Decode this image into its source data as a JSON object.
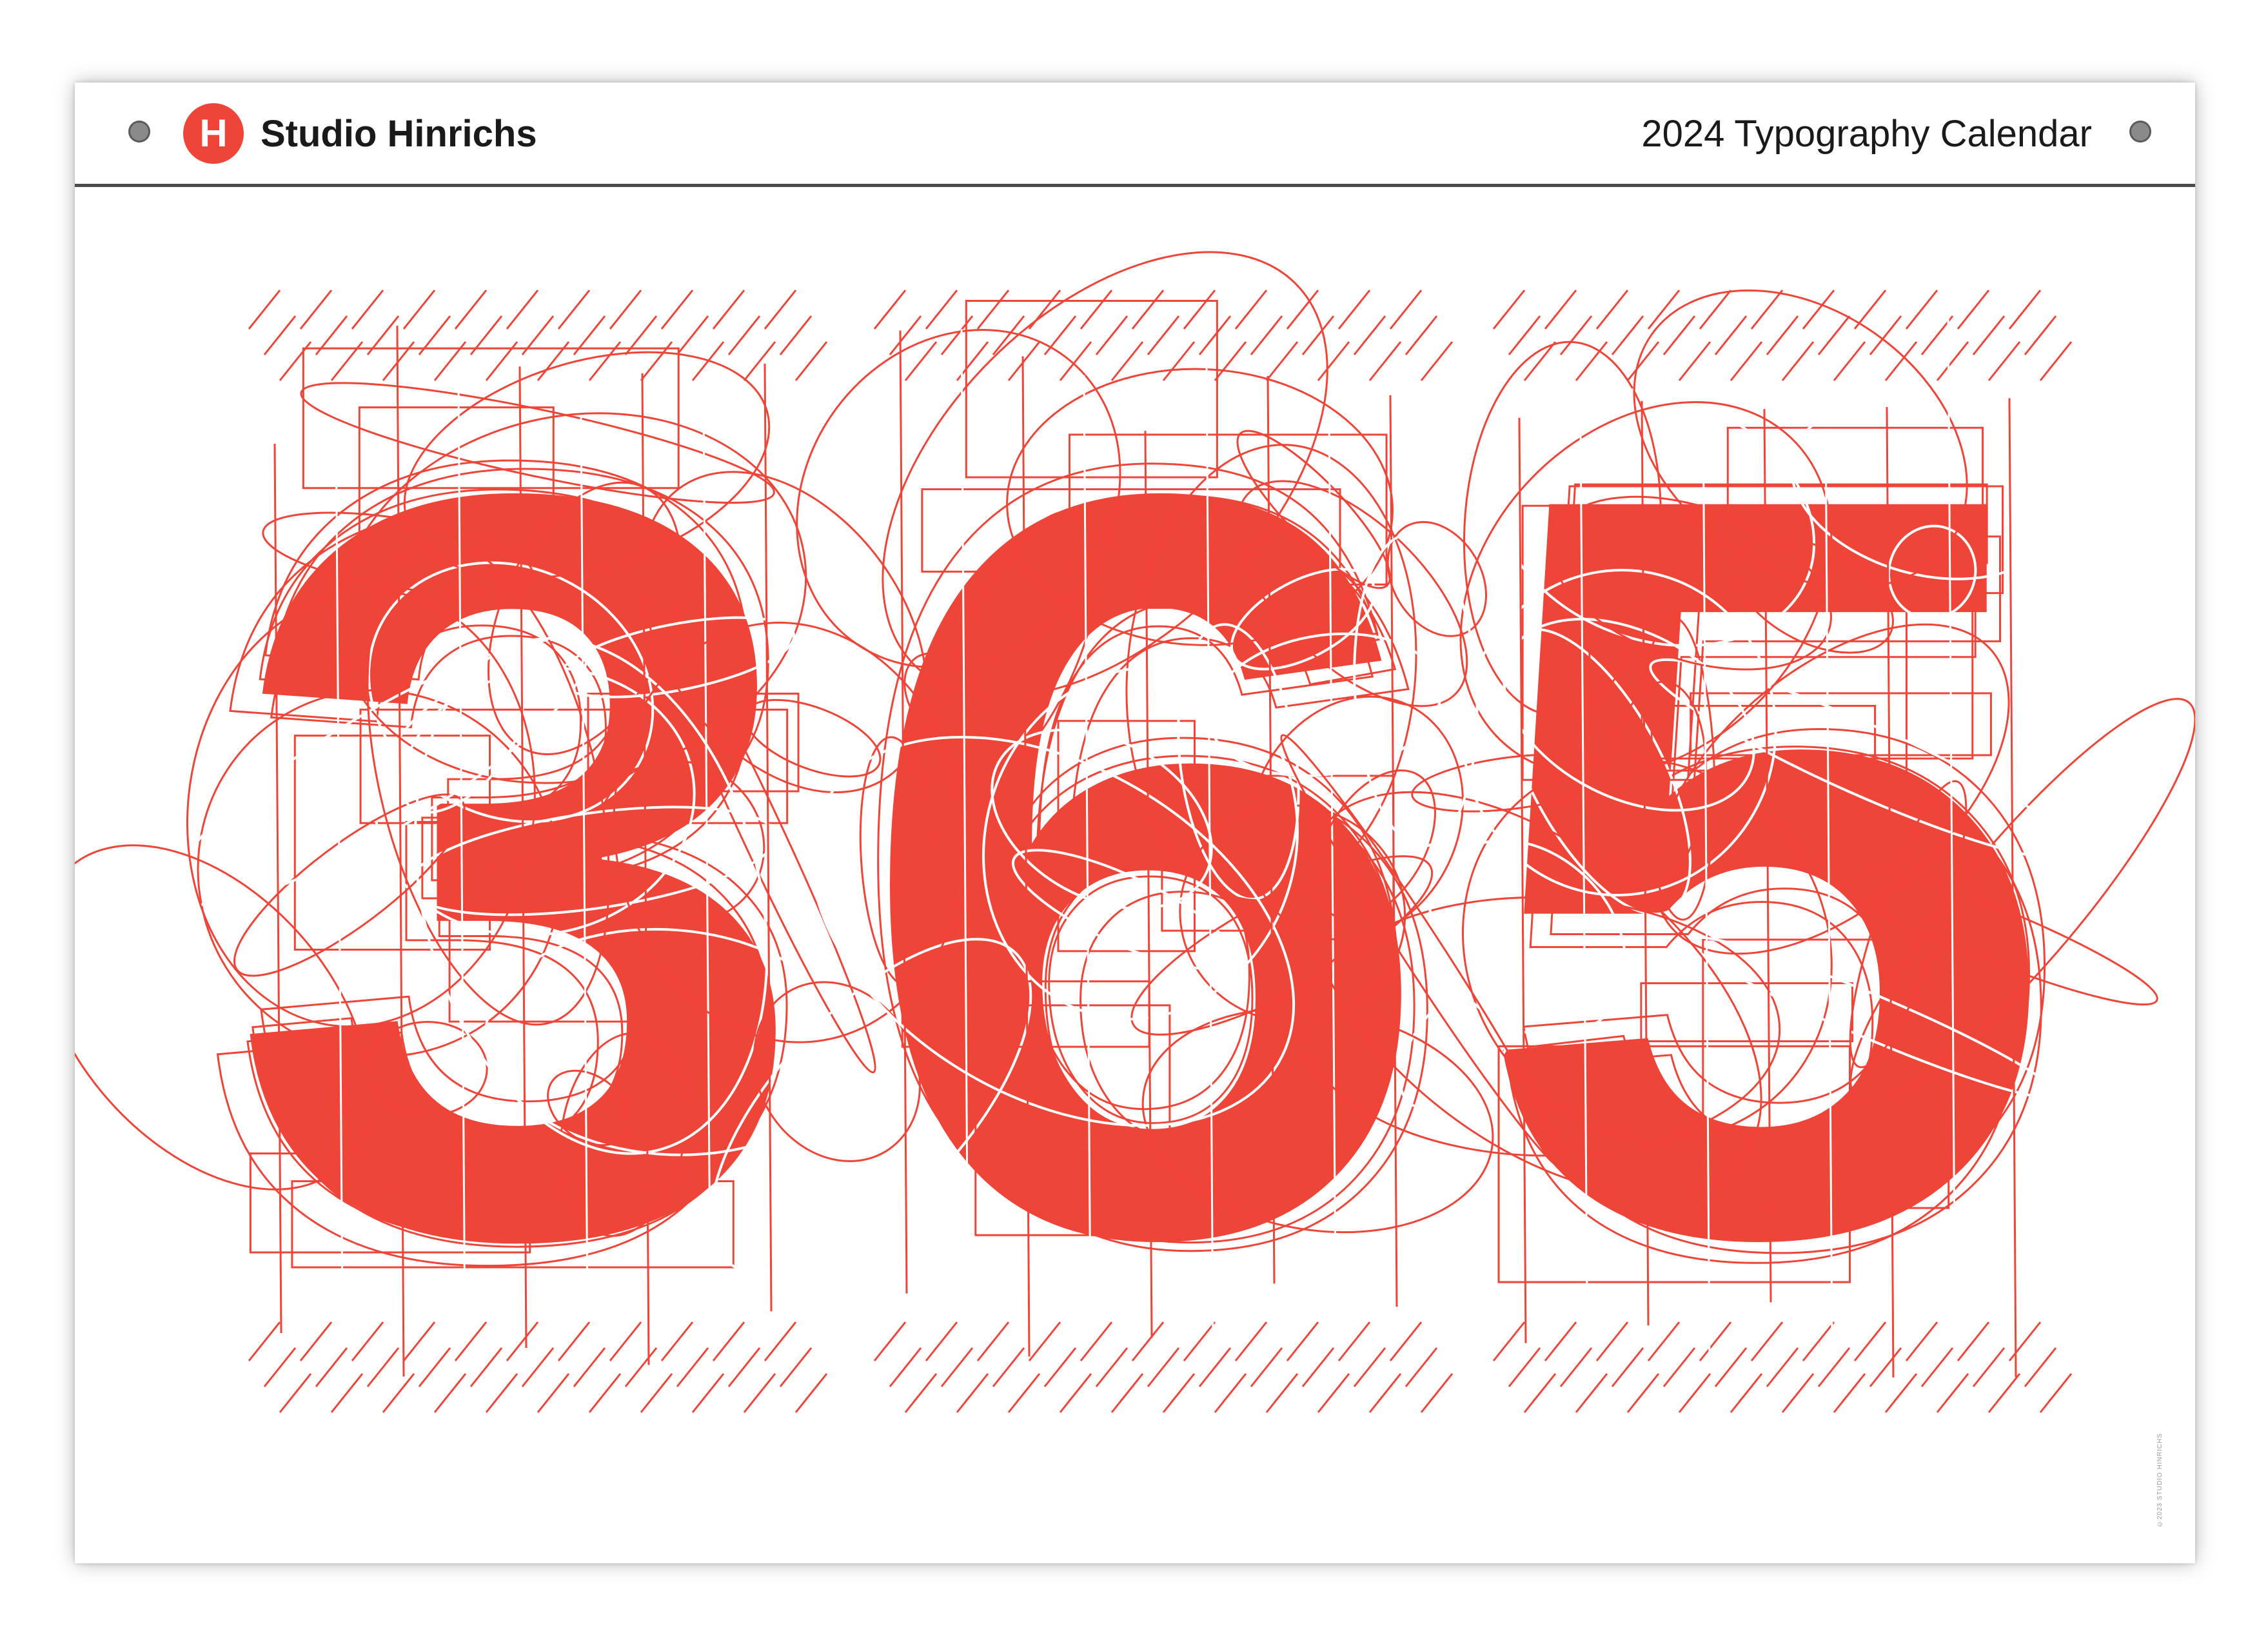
{
  "header": {
    "logo_letter": "H",
    "studio_name": "Studio Hinrichs",
    "calendar_title": "2024 Typography Calendar"
  },
  "artwork": {
    "digits": [
      "3",
      "6",
      "5"
    ],
    "accent_color": "#ef4438"
  },
  "footer": {
    "copyright": "©2023 STUDIO HINRICHS"
  }
}
